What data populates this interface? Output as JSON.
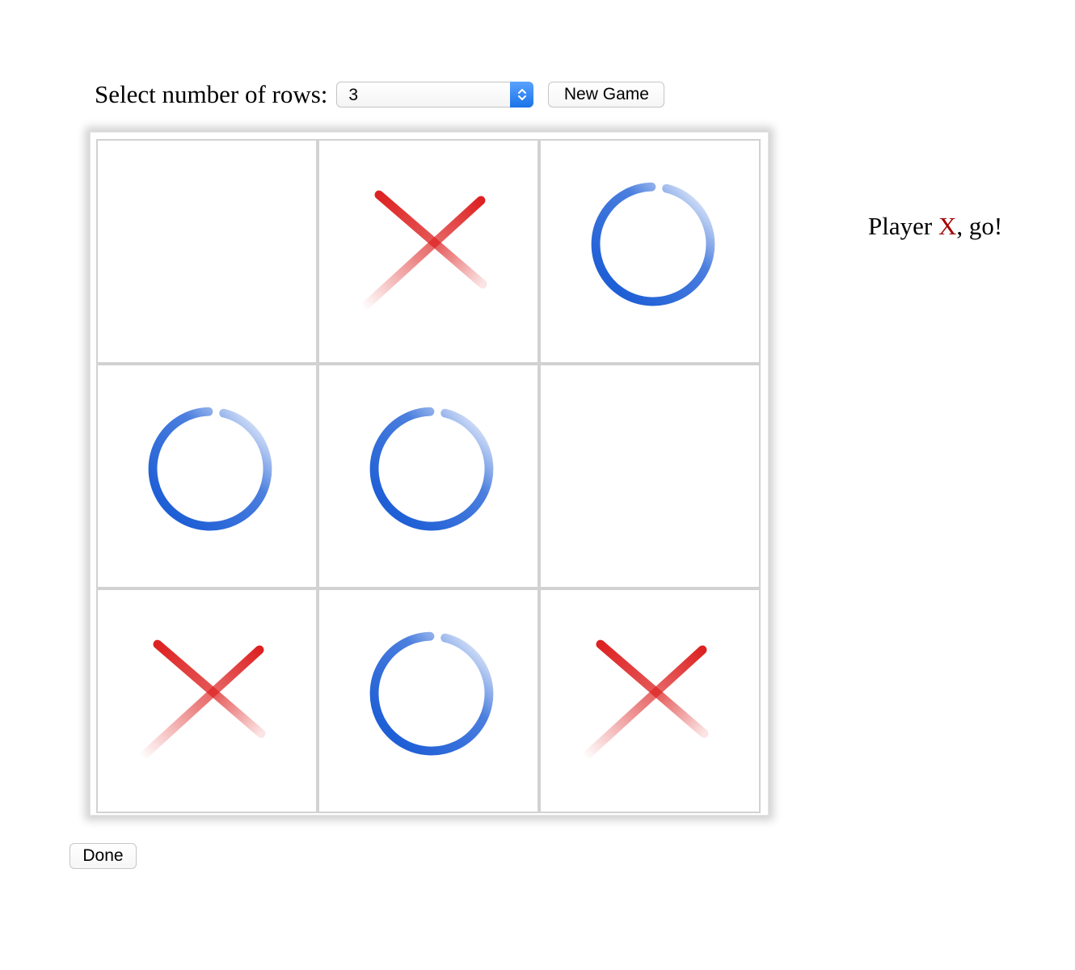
{
  "controls": {
    "rows_label": "Select number of rows:",
    "rows_value": "3",
    "new_game_label": "New Game"
  },
  "board": {
    "size": 3,
    "cells": [
      "",
      "X",
      "O",
      "O",
      "O",
      "",
      "X",
      "O",
      "X"
    ]
  },
  "status": {
    "prefix": "Player ",
    "player": "X",
    "suffix": ", go!"
  },
  "done_label": "Done",
  "colors": {
    "x_mark": "#dd2222",
    "o_mark": "#1f5fd6",
    "status_player": "#a30000"
  },
  "icons": {
    "x_mark": "x-mark-icon",
    "o_mark": "o-mark-icon",
    "select_arrows": "chevron-updown-icon"
  }
}
